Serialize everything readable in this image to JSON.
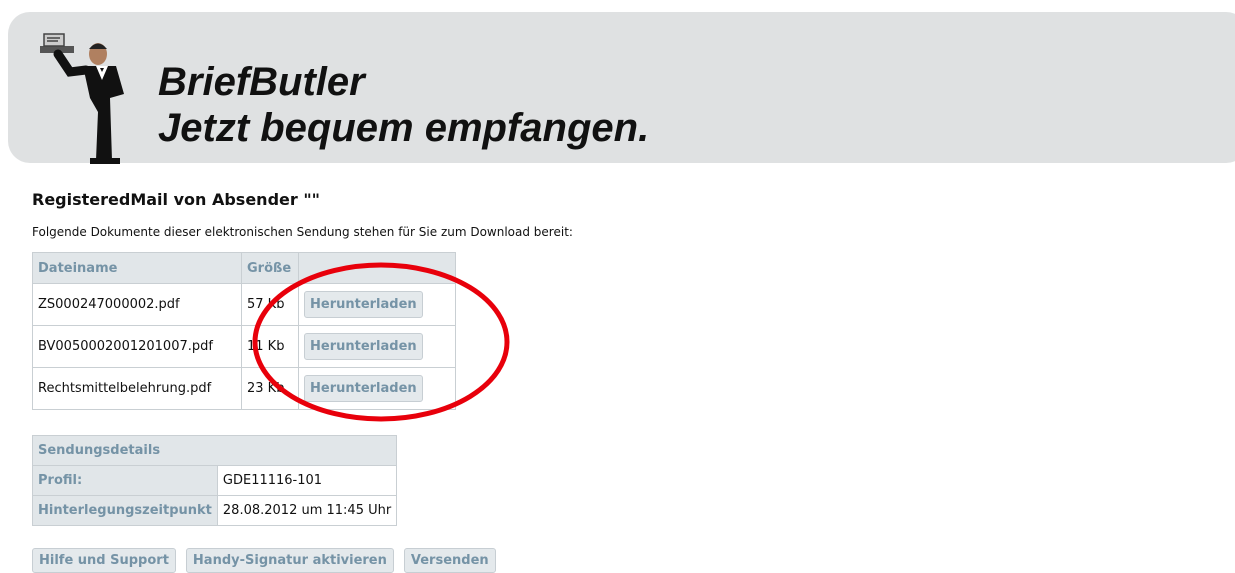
{
  "header": {
    "brand_title": "BriefButler",
    "brand_tagline": "Jetzt bequem empfangen."
  },
  "page": {
    "title": "RegisteredMail von Absender \"\"",
    "intro": "Folgende Dokumente dieser elektronischen Sendung stehen für Sie zum Download bereit:"
  },
  "documents": {
    "headers": [
      "Dateiname",
      "Größe",
      ""
    ],
    "rows": [
      {
        "name": "ZS000247000002.pdf",
        "size": "57 Kb",
        "action": "Herunterladen"
      },
      {
        "name": "BV0050002001201007.pdf",
        "size": "11 Kb",
        "action": "Herunterladen"
      },
      {
        "name": "Rechtsmittelbelehrung.pdf",
        "size": "23 Kb",
        "action": "Herunterladen"
      }
    ]
  },
  "details": {
    "title": "Sendungsdetails",
    "rows": [
      {
        "label": "Profil:",
        "value": "GDE11116-101"
      },
      {
        "label": "Hinterlegungszeitpunkt",
        "value": "28.08.2012 um 11:45 Uhr"
      }
    ]
  },
  "footer": {
    "buttons": [
      "Hilfe und Support",
      "Handy-Signatur aktivieren",
      "Versenden"
    ]
  },
  "colors": {
    "banner": "#dfe1e2",
    "header_cell": "#e1e6e9",
    "header_text": "#7593a6",
    "annotation": "#e8000b"
  }
}
